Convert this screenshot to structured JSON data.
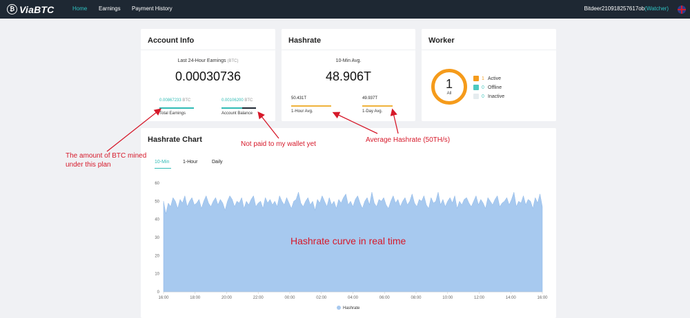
{
  "brand": {
    "name": "ViaBTC",
    "logo_glyph": "₿"
  },
  "nav": {
    "home": "Home",
    "earnings": "Earnings",
    "payment_history": "Payment History"
  },
  "account": {
    "name": "Bitdeer210918257617ob",
    "role": "(Watcher)"
  },
  "account_info": {
    "title": "Account Info",
    "earnings_label": "Last 24-Hour Earnings",
    "earnings_unit": "(BTC)",
    "earnings_value": "0.00030736",
    "total_value": "0.00867233",
    "total_unit": "BTC",
    "total_label": "Total Earnings",
    "balance_value": "0.00106200",
    "balance_unit": "BTC",
    "balance_label": "Account Balance"
  },
  "hashrate": {
    "title": "Hashrate",
    "avg_label": "10-Min Avg.",
    "avg_value": "48.906T",
    "hour_value": "50.431T",
    "hour_label": "1-Hour Avg.",
    "day_value": "49.937T",
    "day_label": "1-Day Avg."
  },
  "worker": {
    "title": "Worker",
    "total": "1",
    "total_label": "All",
    "legend": [
      {
        "count": "1",
        "label": "Active",
        "color": "#f59b1b"
      },
      {
        "count": "0",
        "label": "Offline",
        "color": "#4cc9c0"
      },
      {
        "count": "0",
        "label": "Inactive",
        "color": "#e5ecef"
      }
    ]
  },
  "hashrate_chart": {
    "title": "Hashrate Chart",
    "tabs": [
      "10-Min",
      "1-Hour",
      "Daily"
    ],
    "active_tab": "10-Min",
    "legend_label": "Hashrate"
  },
  "chart_data": {
    "type": "area",
    "title": "Hashrate Chart",
    "xlabel": "",
    "ylabel": "",
    "ylim": [
      0,
      60
    ],
    "yticks": [
      0,
      10,
      20,
      30,
      40,
      50,
      60
    ],
    "xticks": [
      "16:00",
      "18:00",
      "20:00",
      "22:00",
      "00:00",
      "02:00",
      "04:00",
      "06:00",
      "08:00",
      "10:00",
      "12:00",
      "14:00",
      "16:00"
    ],
    "grid": false,
    "legend": "bottom",
    "series": [
      {
        "name": "Hashrate",
        "color": "#a7c9ef",
        "values": [
          50,
          43,
          49,
          47,
          52,
          50,
          46,
          51,
          49,
          53,
          47,
          50,
          52,
          48,
          49,
          51,
          46,
          50,
          53,
          49,
          47,
          50,
          52,
          48,
          51,
          49,
          45,
          50,
          53,
          51,
          47,
          50,
          49,
          52,
          46,
          50,
          48,
          51,
          53,
          47,
          49,
          50,
          46,
          52,
          49,
          51,
          48,
          50,
          47,
          53,
          50,
          48,
          52,
          49,
          46,
          50,
          51,
          55,
          49,
          47,
          50,
          52,
          48,
          50,
          45,
          51,
          49,
          53,
          50,
          47,
          52,
          48,
          50,
          46,
          51,
          49,
          52,
          54,
          48,
          50,
          47,
          51,
          53,
          49,
          46,
          50,
          52,
          48,
          55,
          49,
          47,
          51,
          50,
          52,
          48,
          46,
          50,
          53,
          49,
          51,
          47,
          50,
          52,
          48,
          50,
          54,
          49,
          47,
          51,
          50,
          53,
          48,
          46,
          52,
          49,
          50,
          55,
          48,
          51,
          47,
          50,
          52,
          49,
          53,
          46,
          50,
          48,
          51,
          52,
          49,
          47,
          50,
          53,
          48,
          51,
          49,
          46,
          52,
          50,
          48,
          51,
          53,
          47,
          49,
          50,
          52,
          48,
          51,
          55,
          47,
          50,
          49,
          53,
          48,
          51,
          50,
          46,
          52,
          49,
          54,
          47
        ]
      }
    ]
  },
  "annotations": {
    "btc_mined_line1": "The amount of BTC mined",
    "btc_mined_line2": "under this plan",
    "not_paid": "Not paid to my wallet yet",
    "avg_hashrate": "Average Hashrate (50TH/s)",
    "curve": "Hashrate curve in real time"
  }
}
